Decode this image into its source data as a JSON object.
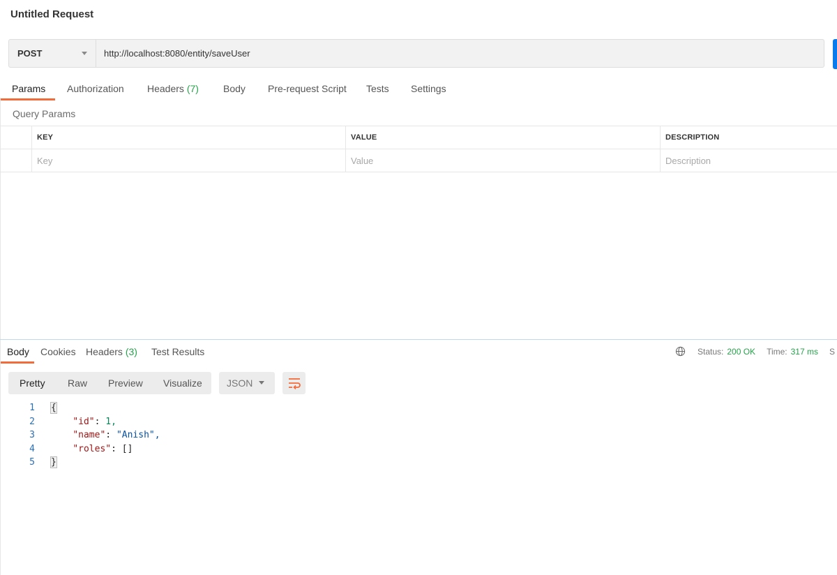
{
  "request": {
    "title": "Untitled Request",
    "method": "POST",
    "url": "http://localhost:8080/entity/saveUser"
  },
  "request_tabs": [
    {
      "label": "Params",
      "count": ""
    },
    {
      "label": "Authorization",
      "count": ""
    },
    {
      "label": "Headers",
      "count": "(7)"
    },
    {
      "label": "Body",
      "count": ""
    },
    {
      "label": "Pre-request Script",
      "count": ""
    },
    {
      "label": "Tests",
      "count": ""
    },
    {
      "label": "Settings",
      "count": ""
    }
  ],
  "query_params": {
    "label": "Query Params",
    "headers": {
      "key": "KEY",
      "value": "VALUE",
      "description": "DESCRIPTION"
    },
    "placeholders": {
      "key": "Key",
      "value": "Value",
      "description": "Description"
    }
  },
  "response_tabs": [
    {
      "label": "Body",
      "count": ""
    },
    {
      "label": "Cookies",
      "count": ""
    },
    {
      "label": "Headers",
      "count": "(3)"
    },
    {
      "label": "Test Results",
      "count": ""
    }
  ],
  "response_status": {
    "status_label": "Status:",
    "status_value": "200 OK",
    "time_label": "Time:",
    "time_value": "317 ms",
    "size_label": "S"
  },
  "view_modes": [
    "Pretty",
    "Raw",
    "Preview",
    "Visualize"
  ],
  "format": "JSON",
  "code_lines": [
    {
      "num": "1",
      "key": "",
      "sep": "{",
      "val": "",
      "val_type": ""
    },
    {
      "num": "2",
      "key": "\"id\"",
      "sep": ": ",
      "val": "1,",
      "val_type": "n"
    },
    {
      "num": "3",
      "key": "\"name\"",
      "sep": ": ",
      "val": "\"Anish\",",
      "val_type": "s"
    },
    {
      "num": "4",
      "key": "\"roles\"",
      "sep": ": ",
      "val": "[]",
      "val_type": "p"
    },
    {
      "num": "5",
      "key": "",
      "sep": "}",
      "val": "",
      "val_type": ""
    }
  ],
  "colors": {
    "accent": "#f26b3a",
    "success": "#26a34a",
    "send": "#097bed"
  }
}
